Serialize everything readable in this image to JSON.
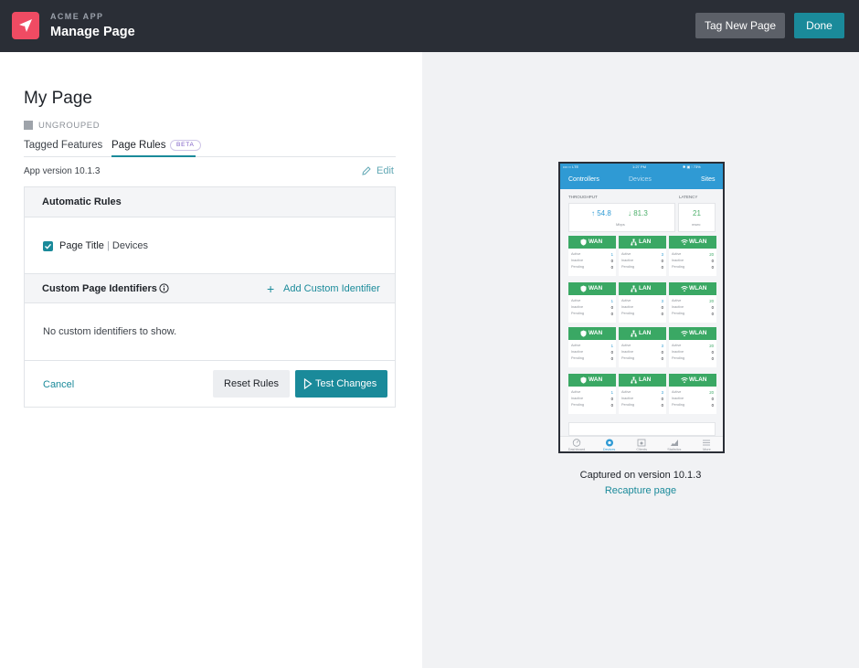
{
  "header": {
    "app_kicker": "ACME APP",
    "title": "Manage Page",
    "tag_new_page_label": "Tag New Page",
    "done_label": "Done"
  },
  "page": {
    "title": "My Page",
    "group_label": "UNGROUPED",
    "tabs": [
      {
        "label": "Tagged Features"
      },
      {
        "label": "Page Rules",
        "badge": "BETA",
        "active": true
      }
    ],
    "app_version": "App version 10.1.3",
    "edit_label": "Edit"
  },
  "rules": {
    "automatic_title": "Automatic Rules",
    "rule": {
      "name": "Page Title",
      "separator": "|",
      "value": "Devices",
      "checked": true
    },
    "custom_title": "Custom Page Identifiers",
    "add_identifier_label": "Add Custom Identifier",
    "empty_text": "No custom identifiers to show.",
    "cancel_label": "Cancel",
    "reset_label": "Reset Rules",
    "test_label": "Test Changes"
  },
  "preview": {
    "captured_text": "Captured on version 10.1.3",
    "recapture_label": "Recapture page",
    "phone": {
      "status": {
        "left": "•••○○ LTE",
        "time": "1:27 PM",
        "right": "✱ ▣ ⁝ 73%"
      },
      "nav": {
        "left": "Controllers",
        "center": "Devices",
        "right": "Sites"
      },
      "throughput_label": "THROUGHPUT",
      "latency_label": "LATENCY",
      "up_value": "↑ 54.8",
      "down_value": "↓ 81.3",
      "throughput_unit": "Mbps",
      "latency_value": "21",
      "latency_unit": "msec",
      "cards": [
        "WAN",
        "LAN",
        "WLAN"
      ],
      "row_labels": [
        "Active",
        "Inactive",
        "Pending"
      ],
      "values": {
        "WAN": [
          "1",
          "0",
          "0"
        ],
        "LAN": [
          "3",
          "0",
          "0"
        ],
        "WLAN": [
          "20",
          "0",
          "0"
        ]
      },
      "tabbar": [
        "Dashboard",
        "Devices",
        "Clients",
        "Statistics",
        "More"
      ]
    }
  },
  "colors": {
    "accent": "#1a8a9a",
    "header_bg": "#2a2e36",
    "logo": "#ef4b63",
    "phone_blue": "#2f9ad4",
    "phone_green": "#3aa864"
  }
}
